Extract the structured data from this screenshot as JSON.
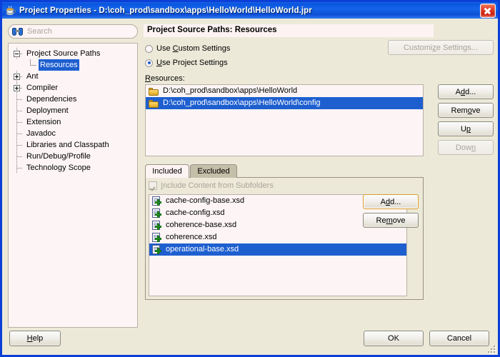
{
  "window": {
    "title": "Project Properties - D:\\coh_prod\\sandbox\\apps\\HelloWorld\\HelloWorld.jpr",
    "icon": "java-coffee-icon",
    "close_label": "Close",
    "colors": {
      "titlebar": "#0d4fd6",
      "selection": "#1e5fd0",
      "frame": "#0b3fd8",
      "dialog_bg": "#ece9d8",
      "field_bg": "#fdf5f5",
      "focus_border": "#d89a28"
    }
  },
  "sidebar": {
    "search": {
      "placeholder": "Search",
      "value": "",
      "icon": "binoculars-icon"
    },
    "tree": [
      {
        "label": "Project Source Paths",
        "expander": "minus",
        "level": 0,
        "selected": false
      },
      {
        "label": "Resources",
        "expander": "none",
        "level": 1,
        "selected": true
      },
      {
        "label": "Ant",
        "expander": "plus",
        "level": 0,
        "selected": false
      },
      {
        "label": "Compiler",
        "expander": "plus",
        "level": 0,
        "selected": false
      },
      {
        "label": "Dependencies",
        "expander": "none",
        "level": 0,
        "selected": false
      },
      {
        "label": "Deployment",
        "expander": "none",
        "level": 0,
        "selected": false
      },
      {
        "label": "Extension",
        "expander": "none",
        "level": 0,
        "selected": false
      },
      {
        "label": "Javadoc",
        "expander": "none",
        "level": 0,
        "selected": false
      },
      {
        "label": "Libraries and Classpath",
        "expander": "none",
        "level": 0,
        "selected": false
      },
      {
        "label": "Run/Debug/Profile",
        "expander": "none",
        "level": 0,
        "selected": false
      },
      {
        "label": "Technology Scope",
        "expander": "none",
        "level": 0,
        "selected": false
      }
    ]
  },
  "main": {
    "page_title": "Project Source Paths: Resources",
    "settings_scope": {
      "custom_label": "Use Custom Settings",
      "project_label": "Use Project Settings",
      "selected": "project",
      "customize_button": "Customize Settings...",
      "customize_enabled": false
    },
    "resources": {
      "label": "Resources:",
      "items": [
        {
          "path": "D:\\coh_prod\\sandbox\\apps\\HelloWorld",
          "selected": false
        },
        {
          "path": "D:\\coh_prod\\sandbox\\apps\\HelloWorld\\config",
          "selected": true
        }
      ],
      "buttons": [
        {
          "label": "Add...",
          "enabled": true,
          "focused": false
        },
        {
          "label": "Remove",
          "enabled": true,
          "focused": false
        },
        {
          "label": "Up",
          "enabled": true,
          "focused": false
        },
        {
          "label": "Down",
          "enabled": false,
          "focused": false
        }
      ]
    },
    "tabs": [
      {
        "label": "Included",
        "active": true
      },
      {
        "label": "Excluded",
        "active": false
      }
    ],
    "subfolders": {
      "label": "Include Content from Subfolders",
      "checked": true,
      "enabled": false
    },
    "files": {
      "items": [
        {
          "name": "cache-config-base.xsd",
          "selected": false
        },
        {
          "name": "cache-config.xsd",
          "selected": false
        },
        {
          "name": "coherence-base.xsd",
          "selected": false
        },
        {
          "name": "coherence.xsd",
          "selected": false
        },
        {
          "name": "operational-base.xsd",
          "selected": true
        }
      ],
      "buttons": [
        {
          "label": "Add...",
          "enabled": true,
          "focused": true
        },
        {
          "label": "Remove",
          "enabled": true,
          "focused": false
        }
      ]
    }
  },
  "footer": {
    "help": "Help",
    "ok": "OK",
    "cancel": "Cancel"
  }
}
